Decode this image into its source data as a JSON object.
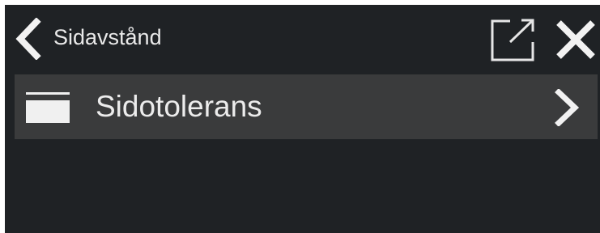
{
  "header": {
    "title": "Sidavstånd",
    "back_icon": "chevron-left-icon",
    "popout_icon": "external-link-icon",
    "close_icon": "close-icon"
  },
  "menu": {
    "items": [
      {
        "label": "Sidotolerans",
        "icon": "page-edge-icon",
        "chevron_icon": "chevron-right-icon"
      }
    ]
  },
  "colors": {
    "background": "#1f2225",
    "row_background": "#3a3b3c",
    "foreground": "#ececec"
  }
}
